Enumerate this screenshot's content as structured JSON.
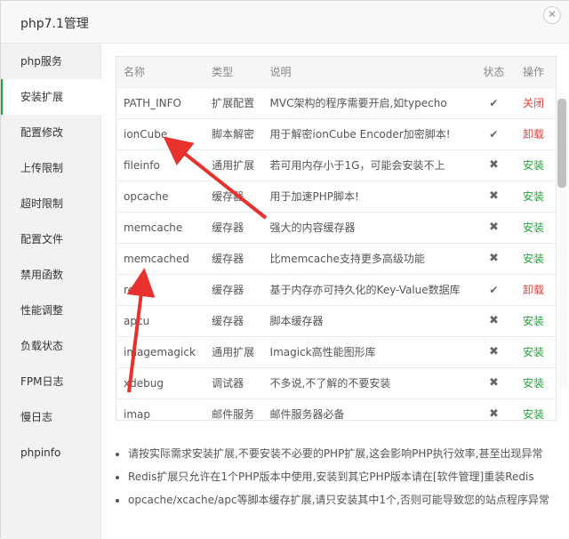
{
  "dialog": {
    "title": "php7.1管理",
    "close_glyph": "✕"
  },
  "sidebar": {
    "items": [
      {
        "label": "php服务"
      },
      {
        "label": "安装扩展"
      },
      {
        "label": "配置修改"
      },
      {
        "label": "上传限制"
      },
      {
        "label": "超时限制"
      },
      {
        "label": "配置文件"
      },
      {
        "label": "禁用函数"
      },
      {
        "label": "性能调整"
      },
      {
        "label": "负载状态"
      },
      {
        "label": "FPM日志"
      },
      {
        "label": "慢日志"
      },
      {
        "label": "phpinfo"
      }
    ],
    "active_index": 1
  },
  "table": {
    "headers": {
      "name": "名称",
      "type": "类型",
      "desc": "说明",
      "status": "状态",
      "op": "操作"
    },
    "rows": [
      {
        "name": "PATH_INFO",
        "type": "扩展配置",
        "desc": "MVC架构的程序需要开启,如typecho",
        "status": "✔",
        "op": "关闭",
        "op_color": "#e8413c"
      },
      {
        "name": "ionCube",
        "type": "脚本解密",
        "desc": "用于解密ionCube Encoder加密脚本!",
        "status": "✔",
        "op": "卸载",
        "op_color": "#e8413c"
      },
      {
        "name": "fileinfo",
        "type": "通用扩展",
        "desc": "若可用内存小于1G，可能会安装不上",
        "status": "✖",
        "op": "安装",
        "op_color": "#20a53a"
      },
      {
        "name": "opcache",
        "type": "缓存器",
        "desc": "用于加速PHP脚本!",
        "status": "✖",
        "op": "安装",
        "op_color": "#20a53a"
      },
      {
        "name": "memcache",
        "type": "缓存器",
        "desc": "强大的内容缓存器",
        "status": "✖",
        "op": "安装",
        "op_color": "#20a53a"
      },
      {
        "name": "memcached",
        "type": "缓存器",
        "desc": "比memcache支持更多高级功能",
        "status": "✖",
        "op": "安装",
        "op_color": "#20a53a"
      },
      {
        "name": "redis",
        "type": "缓存器",
        "desc": "基于内存亦可持久化的Key-Value数据库",
        "status": "✔",
        "op": "卸载",
        "op_color": "#e8413c"
      },
      {
        "name": "apcu",
        "type": "缓存器",
        "desc": "脚本缓存器",
        "status": "✖",
        "op": "安装",
        "op_color": "#20a53a"
      },
      {
        "name": "imagemagick",
        "type": "通用扩展",
        "desc": "Imagick高性能图形库",
        "status": "✖",
        "op": "安装",
        "op_color": "#20a53a"
      },
      {
        "name": "xdebug",
        "type": "调试器",
        "desc": "不多说,不了解的不要安装",
        "status": "✖",
        "op": "安装",
        "op_color": "#20a53a"
      },
      {
        "name": "imap",
        "type": "邮件服务",
        "desc": "邮件服务器必备",
        "status": "✖",
        "op": "安装",
        "op_color": "#20a53a"
      }
    ]
  },
  "tips": [
    "请按实际需求安装扩展,不要安装不必要的PHP扩展,这会影响PHP执行效率,甚至出现异常",
    "Redis扩展只允许在1个PHP版本中使用,安装到其它PHP版本请在[软件管理]重装Redis",
    "opcache/xcache/apc等脚本缓存扩展,请只安装其中1个,否则可能导致您的站点程序异常"
  ],
  "colors": {
    "accent": "#20a53a",
    "danger": "#e8413c",
    "annotation_arrow": "#e8312c"
  }
}
